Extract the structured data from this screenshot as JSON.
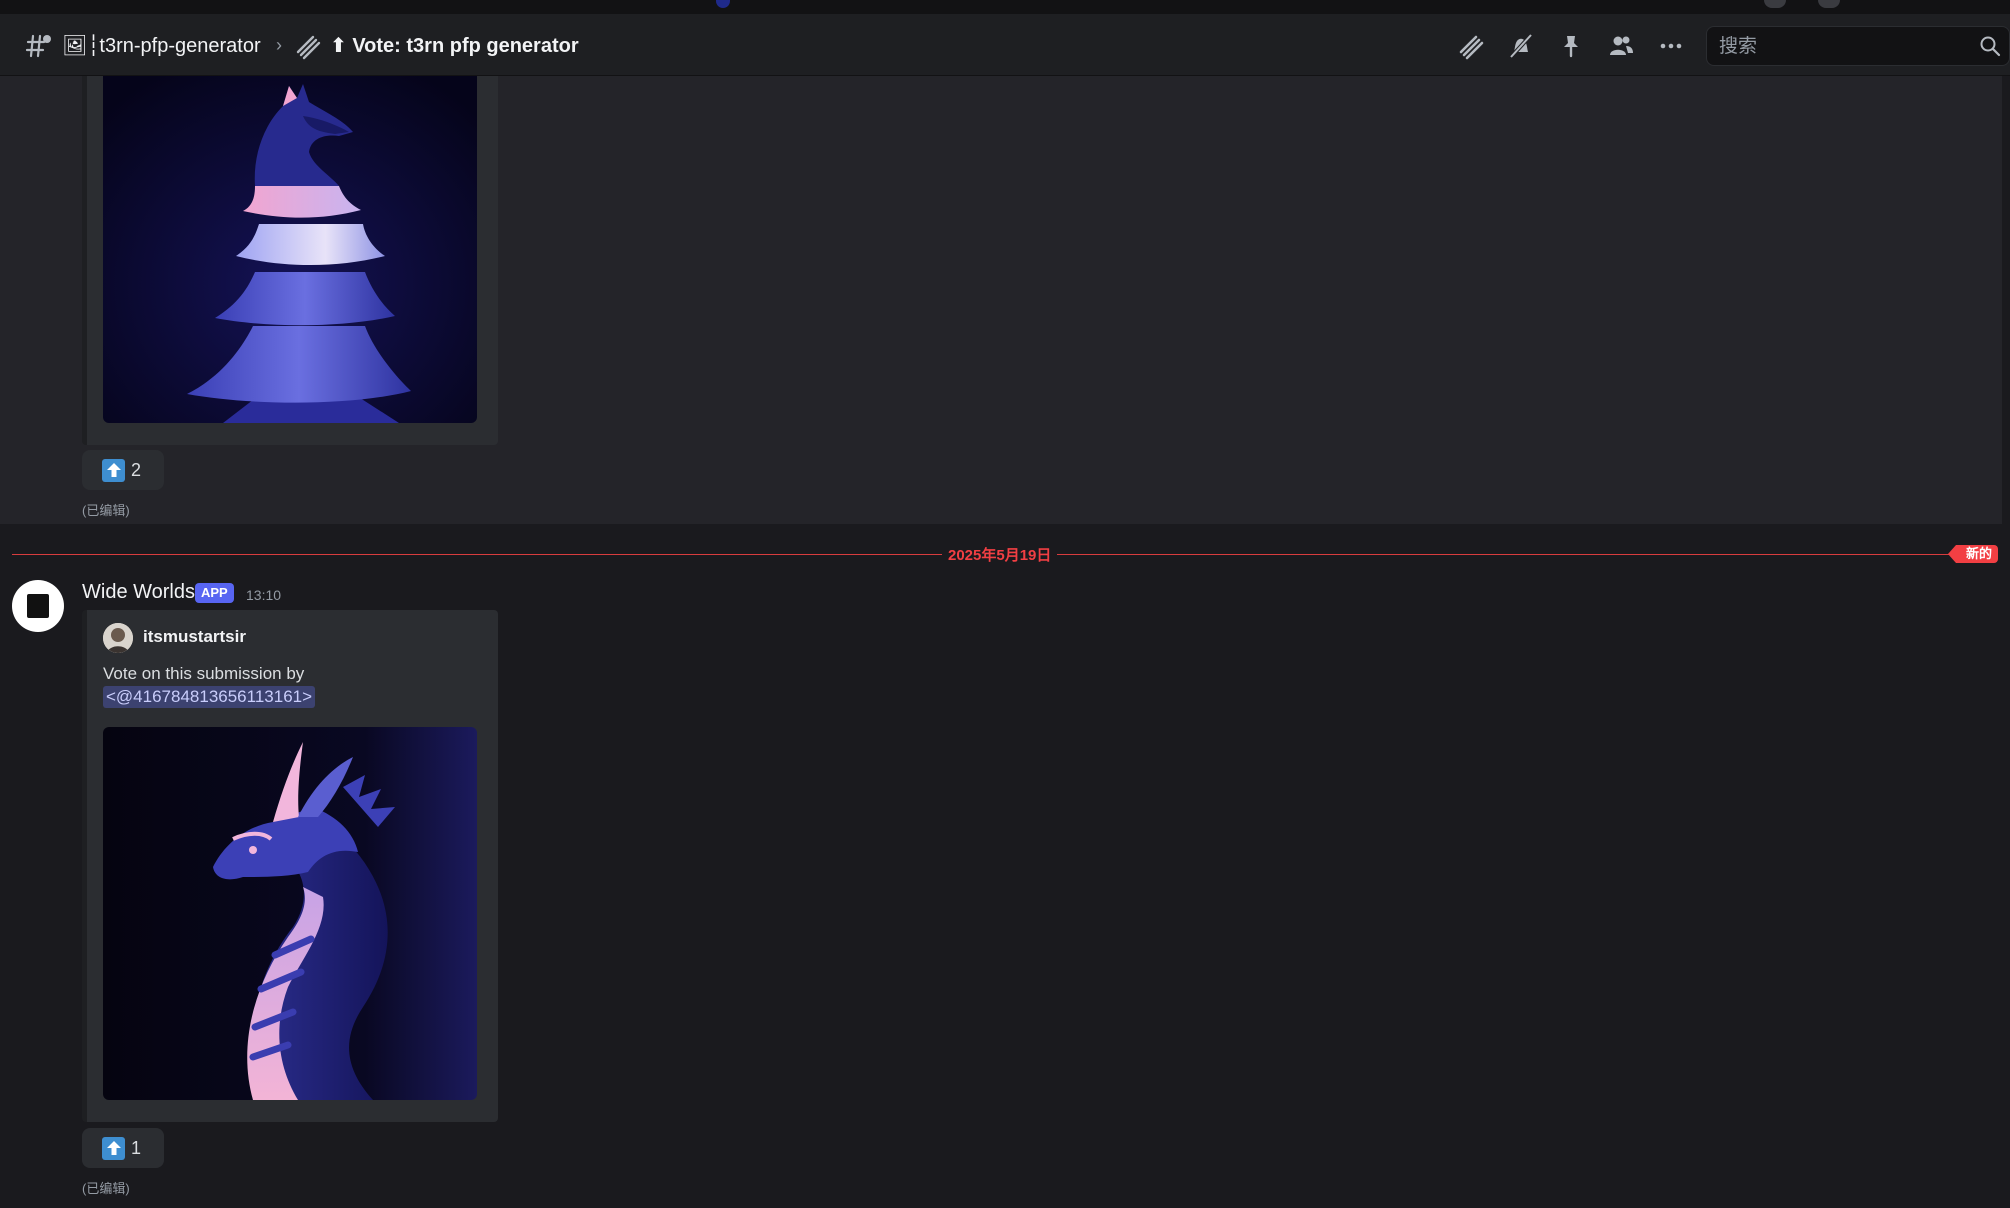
{
  "header": {
    "channel_name": "🖼┆t3rn-pfp-generator",
    "separator": "›",
    "thread_name": "⬆ Vote: t3rn pfp generator",
    "search_placeholder": "搜索"
  },
  "messages": [
    {
      "reaction": {
        "emoji": "arrow-up",
        "count": "2"
      },
      "edited_label": "(已编辑)"
    },
    {
      "username": "Wide Worlds",
      "badge": "APP",
      "time": "13:10",
      "embed": {
        "author": "itsmustartsir",
        "description": "Vote on this submission by",
        "mention": "<@416784813656113161>"
      },
      "reaction": {
        "emoji": "arrow-up",
        "count": "1"
      },
      "edited_label": "(已编辑)"
    }
  ],
  "divider": {
    "date": "2025年5月19日",
    "new_label": "新的"
  },
  "colors": {
    "accent": "#5865f2",
    "new_divider": "#f23f43",
    "reaction_emoji": "#3e8ed0"
  }
}
